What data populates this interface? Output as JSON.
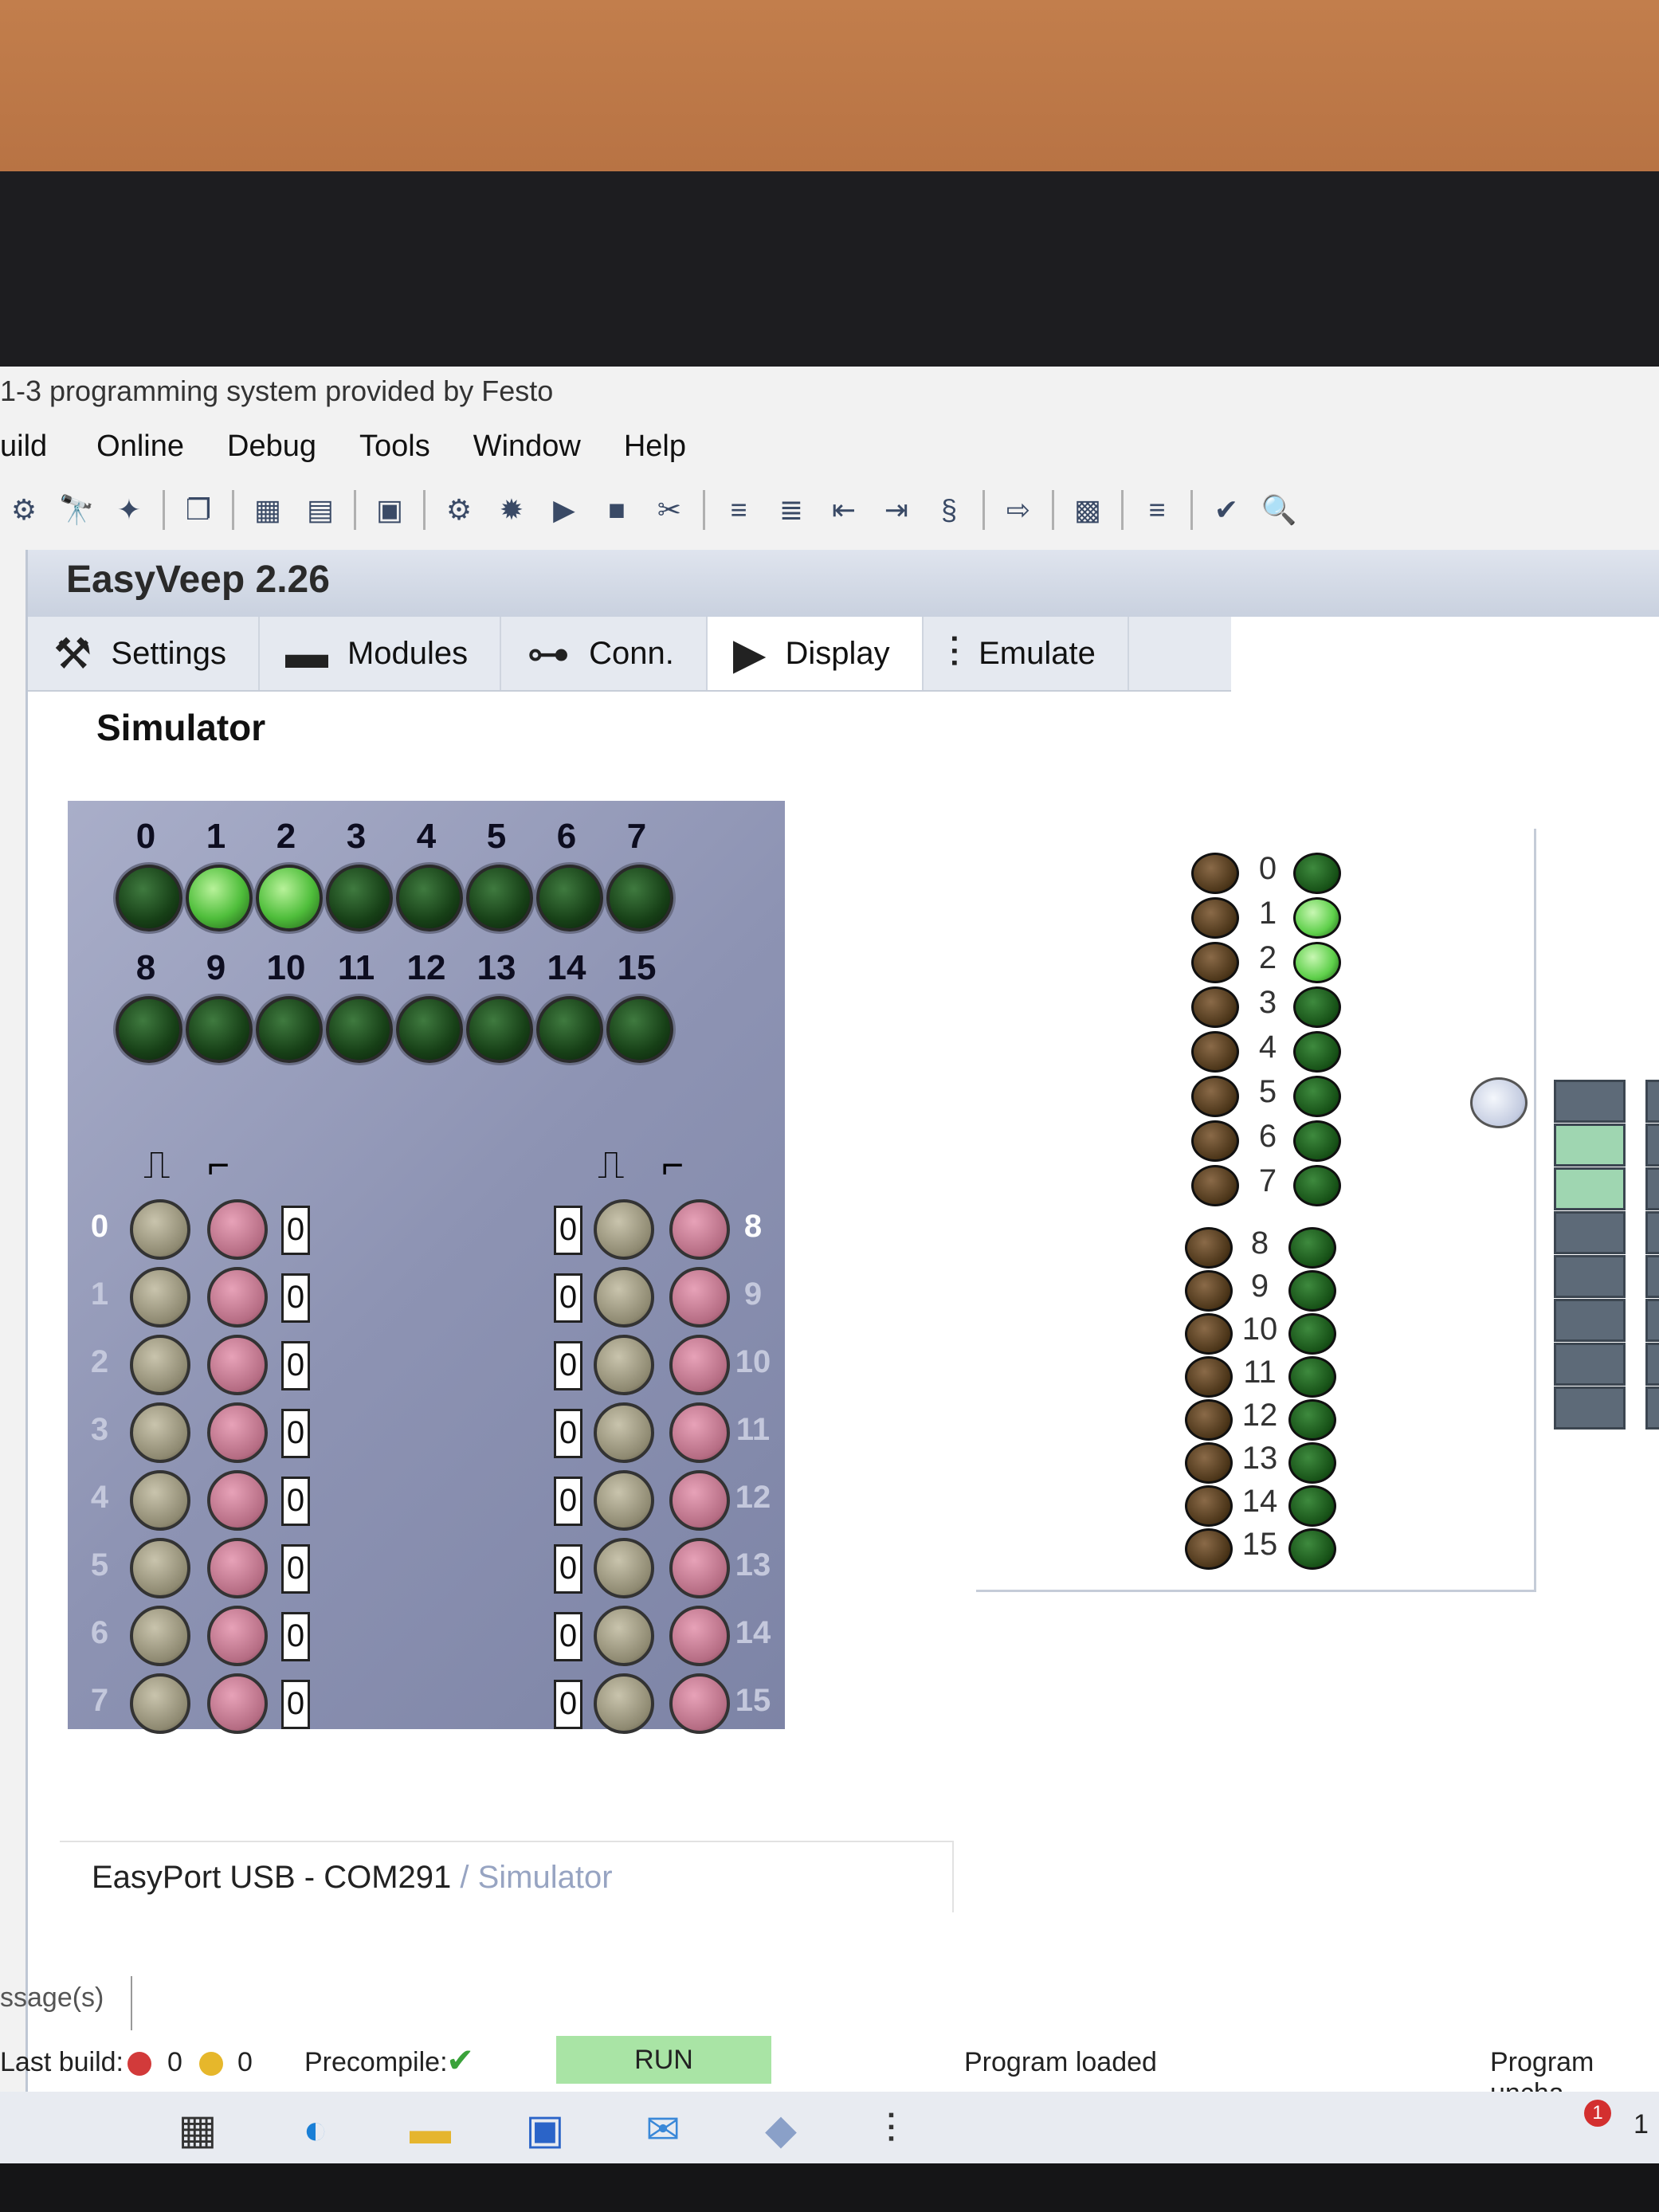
{
  "app": {
    "title": "1-3 programming system provided by Festo"
  },
  "menu": [
    "uild",
    "Online",
    "Debug",
    "Tools",
    "Window",
    "Help"
  ],
  "window": {
    "title": "EasyVeep 2.26"
  },
  "tabs": [
    {
      "label": "Settings",
      "icon": "wrench-icon"
    },
    {
      "label": "Modules",
      "icon": "folder-icon"
    },
    {
      "label": "Conn.",
      "icon": "connection-icon"
    },
    {
      "label": "Display",
      "icon": "play-icon"
    },
    {
      "label": "Emulate",
      "icon": "sliders-icon"
    }
  ],
  "simulator": {
    "label": "Simulator",
    "outputs_row1": [
      "0",
      "1",
      "2",
      "3",
      "4",
      "5",
      "6",
      "7"
    ],
    "outputs_row2": [
      "8",
      "9",
      "10",
      "11",
      "12",
      "13",
      "14",
      "15"
    ],
    "outputs_on": [
      1,
      2
    ],
    "inputs_left": [
      "0",
      "1",
      "2",
      "3",
      "4",
      "5",
      "6",
      "7"
    ],
    "inputs_right": [
      "8",
      "9",
      "10",
      "11",
      "12",
      "13",
      "14",
      "15"
    ],
    "input_value": "0"
  },
  "io_view": {
    "rows_a": [
      "0",
      "1",
      "2",
      "3",
      "4",
      "5",
      "6",
      "7"
    ],
    "rows_b": [
      "8",
      "9",
      "10",
      "11",
      "12",
      "13",
      "14",
      "15"
    ],
    "green_on": [
      1,
      2
    ]
  },
  "status_line": {
    "port": "EasyPort USB - COM291",
    "mode": "/ Simulator"
  },
  "messages_tab": "ssage(s)",
  "statusbar": {
    "last_build": "Last build:",
    "errors": "0",
    "warnings": "0",
    "precompile": "Precompile:",
    "run": "RUN",
    "program": "Program loaded",
    "unchanged": "Program uncha"
  },
  "taskbar": {
    "notification_count": "1",
    "clock": "1"
  },
  "colors": {
    "led_on": "#5ecf4a",
    "led_off": "#174017",
    "panel": "#8d93b3",
    "run": "#a9e4a5"
  }
}
